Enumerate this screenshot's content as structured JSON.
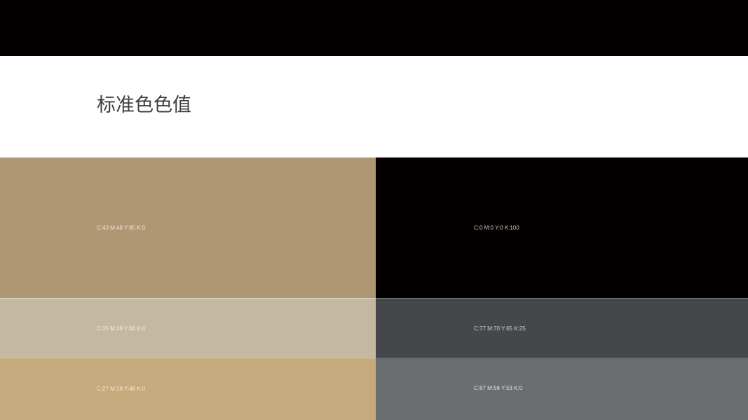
{
  "title": "标准色色值",
  "colors": {
    "top_bar": "#040000",
    "background": "#ffffff",
    "title_text": "#3e3e3e"
  },
  "swatches": {
    "left": [
      {
        "label": "C:43  M:48  Y:85  K:0",
        "color": "#b09774",
        "label_color": "#ece3d6"
      },
      {
        "label": "C:35  M:38  Y:84  K:0",
        "color": "#c4b8a0",
        "label_color": "#f1ece2"
      },
      {
        "label": "C:27  M:28  Y:48  K:0",
        "color": "#c4aa7d",
        "label_color": "#f3ead9"
      }
    ],
    "right": [
      {
        "label": "C:0  M:0  Y:0  K:100",
        "color": "#040000",
        "label_color": "#c8c8c8"
      },
      {
        "label": "C:77  M:70  Y:65  K:25",
        "color": "#45484b",
        "label_color": "#d0d2d4"
      },
      {
        "label": "C:67  M:56  Y:53  K:0",
        "color": "#6b6e6f",
        "label_color": "#e0e2e3"
      }
    ]
  }
}
